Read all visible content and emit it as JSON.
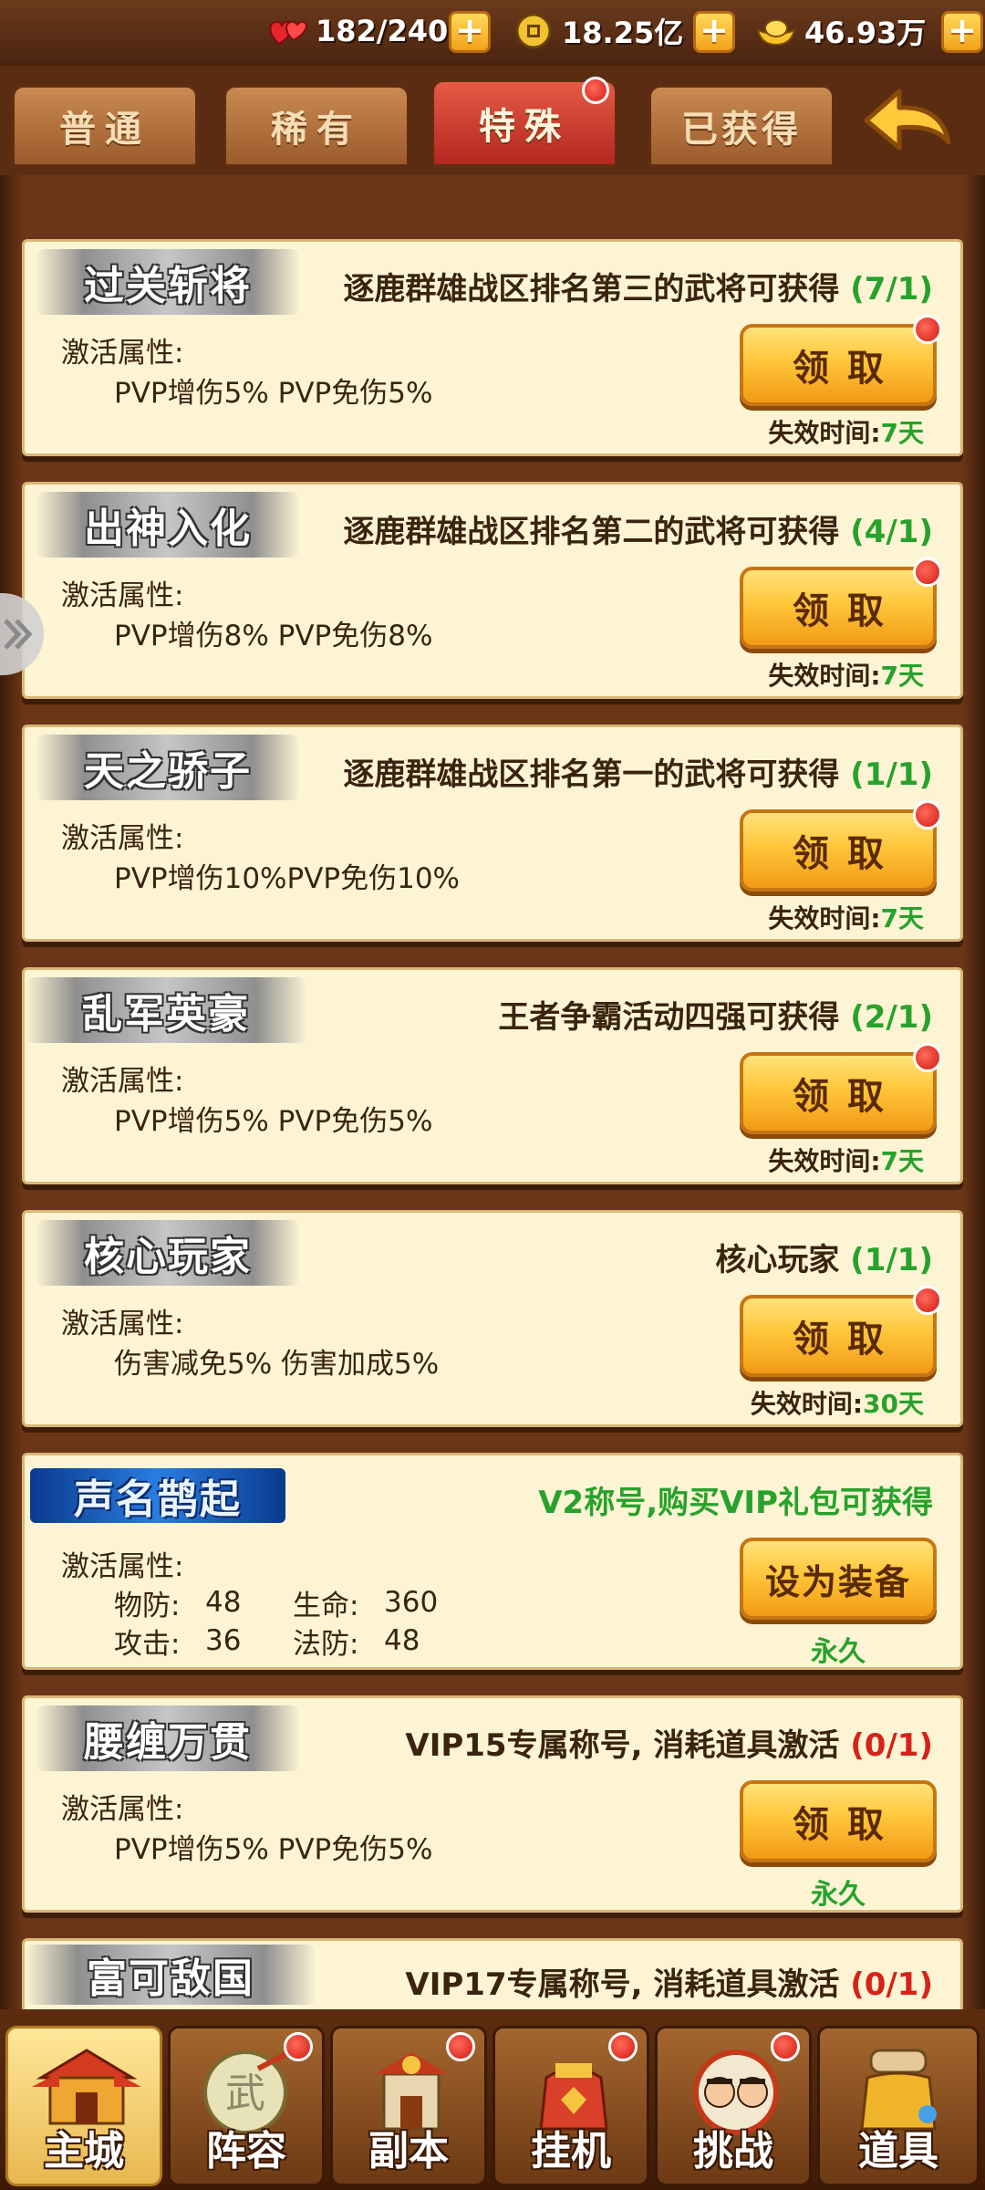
{
  "resources": [
    {
      "icon": "stamina-hearts-icon",
      "value": "182/240"
    },
    {
      "icon": "copper-coin-icon",
      "value": "18.25亿"
    },
    {
      "icon": "gold-ingot-icon",
      "value": "46.93万"
    }
  ],
  "tabs": [
    {
      "label": "普通",
      "active": false,
      "badge": false
    },
    {
      "label": "稀有",
      "active": false,
      "badge": false
    },
    {
      "label": "特殊",
      "active": true,
      "badge": true
    },
    {
      "label": "已获得",
      "active": false,
      "badge": false
    }
  ],
  "titles": [
    {
      "name": "过关斩将",
      "desc": "逐鹿群雄战区排名第三的武将可获得",
      "count": "(7/1)",
      "attr_label": "激活属性:",
      "attr": "PVP增伤5% PVP免伤5%",
      "button": "领取",
      "badge": true,
      "expire_label": "失效时间:",
      "expire_value": "7天"
    },
    {
      "name": "出神入化",
      "desc": "逐鹿群雄战区排名第二的武将可获得",
      "count": "(4/1)",
      "attr_label": "激活属性:",
      "attr": "PVP增伤8% PVP免伤8%",
      "button": "领取",
      "badge": true,
      "expire_label": "失效时间:",
      "expire_value": "7天"
    },
    {
      "name": "天之骄子",
      "desc": "逐鹿群雄战区排名第一的武将可获得",
      "count": "(1/1)",
      "attr_label": "激活属性:",
      "attr": "PVP增伤10%PVP免伤10%",
      "button": "领取",
      "badge": true,
      "expire_label": "失效时间:",
      "expire_value": "7天"
    },
    {
      "name": "乱军英豪",
      "desc": "王者争霸活动四强可获得",
      "count": "(2/1)",
      "attr_label": "激活属性:",
      "attr": "PVP增伤5% PVP免伤5%",
      "button": "领取",
      "badge": true,
      "expire_label": "失效时间:",
      "expire_value": "7天"
    },
    {
      "name": "核心玩家",
      "desc": "核心玩家",
      "count": "(1/1)",
      "attr_label": "激活属性:",
      "attr": "伤害减免5% 伤害加成5%",
      "button": "领取",
      "badge": true,
      "expire_label": "失效时间:",
      "expire_value": "30天"
    }
  ],
  "vip_title": {
    "name": "声名鹊起",
    "desc": "V2称号,购买VIP礼包可获得",
    "attr_label": "激活属性:",
    "stats": [
      {
        "k": "物防:",
        "v": "48",
        "k2": "生命:",
        "v2": "360"
      },
      {
        "k": "攻击:",
        "v": "36",
        "k2": "法防:",
        "v2": "48"
      }
    ],
    "button": "设为装备",
    "duration": "永久"
  },
  "vip15_title": {
    "name": "腰缠万贯",
    "desc": "VIP15专属称号, 消耗道具激活",
    "count": "(0/1)",
    "attr_label": "激活属性:",
    "attr": "PVP增伤5% PVP免伤5%",
    "button": "领取",
    "duration": "永久"
  },
  "vip17_title": {
    "name": "富可敌国",
    "desc": "VIP17专属称号, 消耗道具激活",
    "count": "(0/1)"
  },
  "bottom_nav": [
    {
      "label": "主城",
      "icon": "palace-icon",
      "active": true,
      "badge": false
    },
    {
      "label": "阵容",
      "icon": "scroll-fan-icon",
      "active": false,
      "badge": true
    },
    {
      "label": "副本",
      "icon": "gate-flag-icon",
      "active": false,
      "badge": true
    },
    {
      "label": "挂机",
      "icon": "treasure-bag-icon",
      "active": false,
      "badge": true
    },
    {
      "label": "挑战",
      "icon": "duel-icon",
      "active": false,
      "badge": true
    },
    {
      "label": "道具",
      "icon": "item-jar-icon",
      "active": false,
      "badge": false
    }
  ],
  "colors": {
    "accent_green": "#27a22c",
    "accent_red": "#d6221a",
    "button_gold": "#ffc63a",
    "card_bg": "#fdf4d4",
    "frame_brown": "#5a2d12"
  }
}
